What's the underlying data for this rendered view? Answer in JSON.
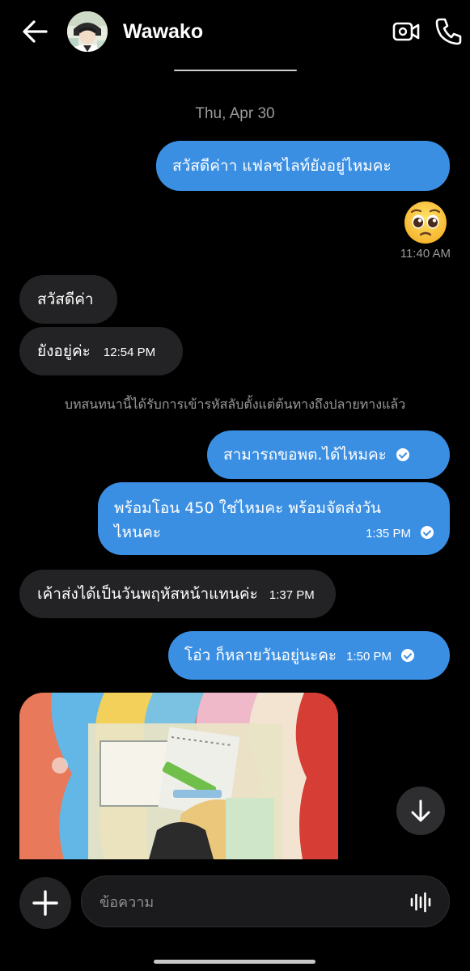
{
  "header": {
    "contact_name": "Wawako",
    "back_icon": "back-arrow-icon",
    "video_icon": "video-camera-icon",
    "call_icon": "phone-icon"
  },
  "conversation": {
    "date_separator": "Thu, Apr 30",
    "messages": [
      {
        "direction": "outgoing",
        "text": "สวัสดีค่าา แฟลชไลท์ยังอยู่ไหมคะ"
      },
      {
        "direction": "outgoing",
        "type": "emoji",
        "emoji": "pleading-face",
        "time": "11:40 AM"
      },
      {
        "direction": "incoming",
        "text": "สวัสดีค่า"
      },
      {
        "direction": "incoming",
        "text": "ยังอยู่ค่ะ",
        "time": "12:54 PM"
      },
      {
        "direction": "outgoing",
        "text": "สามารถขอพต.ได้ไหมคะ",
        "seen": true
      },
      {
        "direction": "outgoing",
        "text_line1": "พร้อมโอน 450 ใช่ไหมคะ พร้อมจัดส่งวัน",
        "text_line2": "ไหนคะ",
        "time": "1:35 PM",
        "seen": true
      },
      {
        "direction": "incoming",
        "text": "เค้าส่งได้เป็นวันพฤหัสหน้าแทนค่ะ",
        "time": "1:37 PM"
      },
      {
        "direction": "outgoing",
        "text": "โอ่ว ก็หลายวันอยู่นะคะ",
        "time": "1:50 PM",
        "seen": true
      },
      {
        "direction": "incoming",
        "type": "photo",
        "photo": "colorful-rug-with-comic-merch-photo"
      }
    ],
    "encryption_notice": "บทสนทนานี้ได้รับการเข้ารหัสลับตั้งแต่ต้นทางถึงปลายทางแล้ว"
  },
  "composer": {
    "placeholder": "ข้อความ",
    "add_icon": "plus-icon",
    "mic_icon": "voice-wave-icon"
  },
  "colors": {
    "outgoing_bubble": "#3b8fe3",
    "incoming_bubble": "#232325",
    "background": "#000000"
  }
}
